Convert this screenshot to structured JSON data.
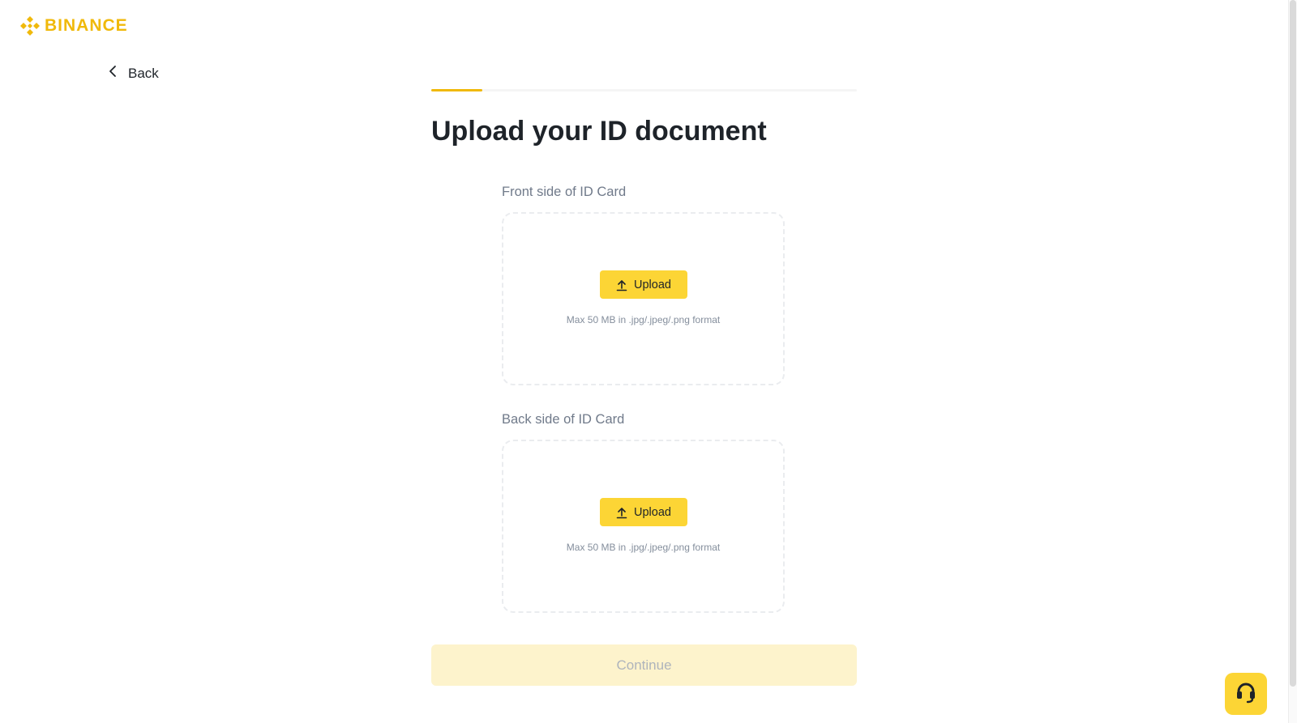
{
  "brand": {
    "name": "BINANCE",
    "color": "#f0b90b",
    "logo_icon": "binance-diamond-icon"
  },
  "nav": {
    "back_label": "Back",
    "back_icon": "chevron-left-icon"
  },
  "progress": {
    "fraction": 0.12,
    "color": "#f0b90b"
  },
  "page": {
    "title": "Upload your ID document"
  },
  "uploads": [
    {
      "label": "Front side of ID Card",
      "button_label": "Upload",
      "button_icon": "upload-icon",
      "hint": "Max 50 MB in .jpg/.jpeg/.png format"
    },
    {
      "label": "Back side of ID Card",
      "button_label": "Upload",
      "button_icon": "upload-icon",
      "hint": "Max 50 MB in .jpg/.jpeg/.png format"
    }
  ],
  "footer": {
    "continue_label": "Continue",
    "continue_disabled": true
  },
  "support": {
    "icon": "headset-icon",
    "color": "#fcd535"
  }
}
